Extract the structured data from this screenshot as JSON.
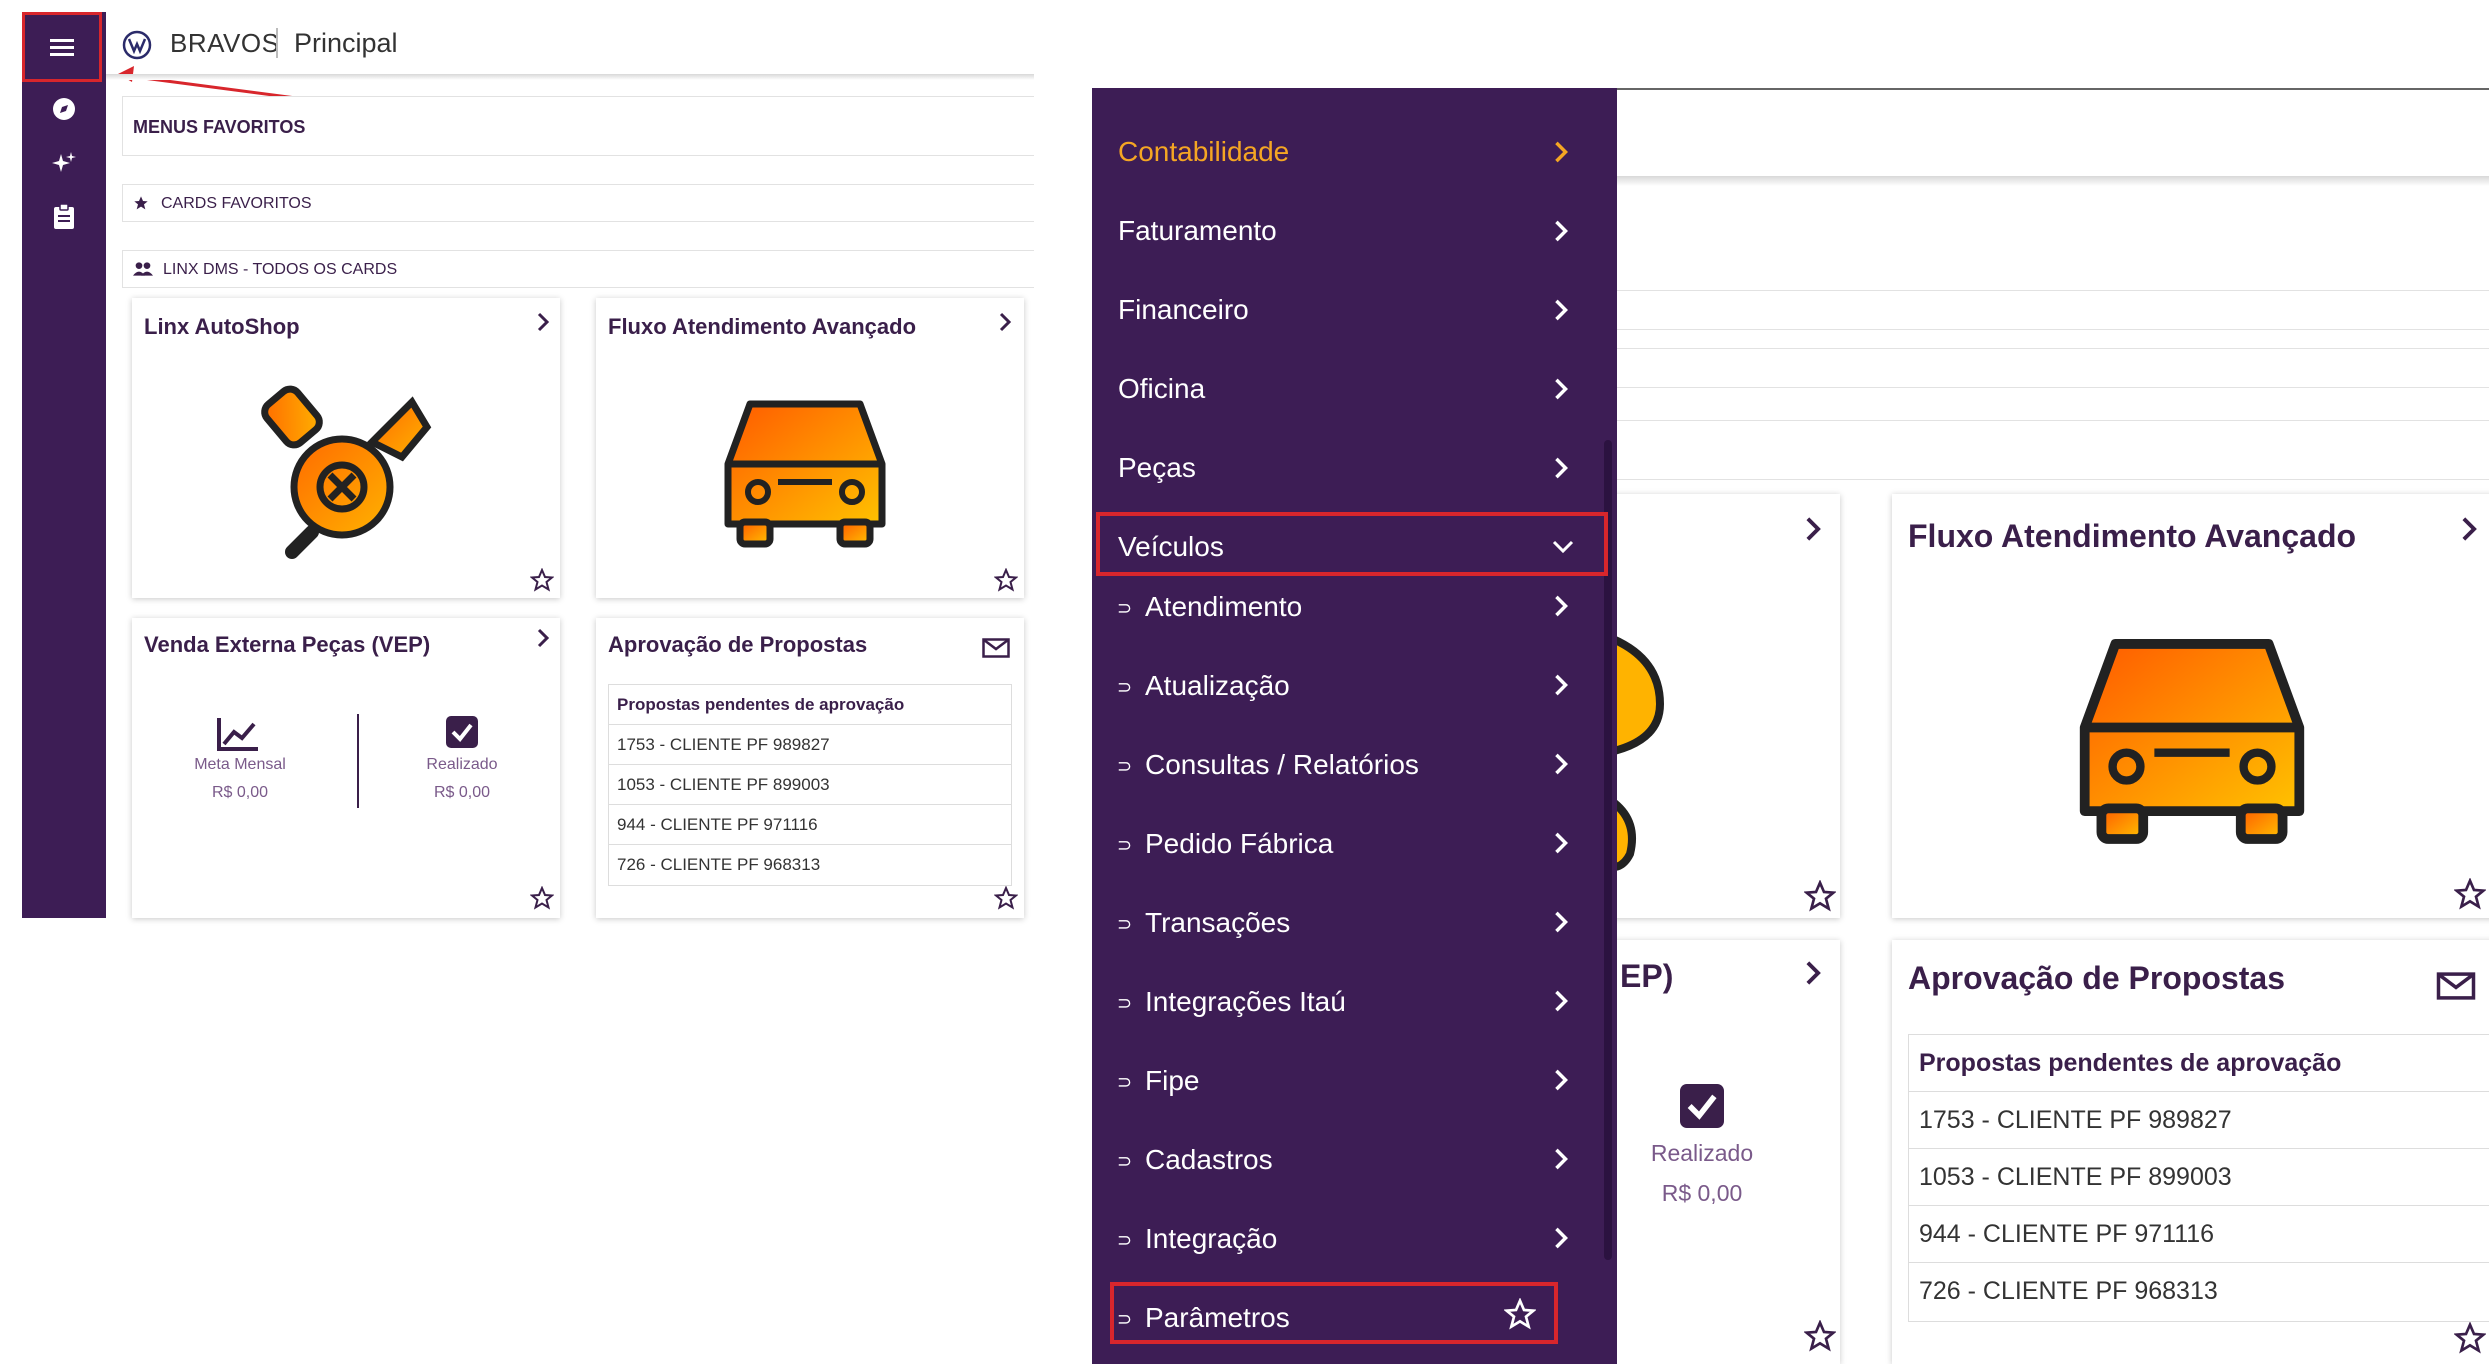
{
  "header": {
    "brand": "BRAVOS",
    "page": "Principal"
  },
  "sidebar": {
    "icons": [
      "menu-icon",
      "compass-icon",
      "sparkles-icon",
      "clipboard-icon"
    ]
  },
  "sections": {
    "favorite_menus": "MENUS FAVORITOS",
    "favorite_cards": "CARDS FAVORITOS",
    "all_cards": "LINX DMS - TODOS OS CARDS"
  },
  "cards": {
    "autoshop": {
      "title": "Linx AutoShop"
    },
    "fluxo": {
      "title": "Fluxo Atendimento Avançado"
    },
    "vep": {
      "title": "Venda Externa Peças (VEP)",
      "meta_label": "Meta Mensal",
      "meta_value": "R$ 0,00",
      "real_label": "Realizado",
      "real_value": "R$ 0,00"
    },
    "propostas": {
      "title": "Aprovação de Propostas",
      "header": "Propostas pendentes de aprovação",
      "rows": [
        "1753 - CLIENTE PF 989827",
        "1053 - CLIENTE PF 899003",
        "944 - CLIENTE PF 971116",
        "726 - CLIENTE PF 968313"
      ]
    }
  },
  "nav_menu": {
    "items": [
      {
        "label": "Contabilidade",
        "color": "#f5a623"
      },
      {
        "label": "Faturamento"
      },
      {
        "label": "Financeiro"
      },
      {
        "label": "Oficina"
      },
      {
        "label": "Peças"
      },
      {
        "label": "Veículos",
        "expanded": true
      }
    ],
    "sub_items": [
      "Atendimento",
      "Atualização",
      "Consultas / Relatórios",
      "Pedido Fábrica",
      "Transações",
      "Integrações Itaú",
      "Fipe",
      "Cadastros",
      "Integração",
      "Parâmetros"
    ]
  },
  "right_partial": {
    "vep_title_fragment": "EP)"
  },
  "colors": {
    "sidebar": "#3d1d55",
    "accent": "#f5a623",
    "highlight": "#d8262c"
  }
}
